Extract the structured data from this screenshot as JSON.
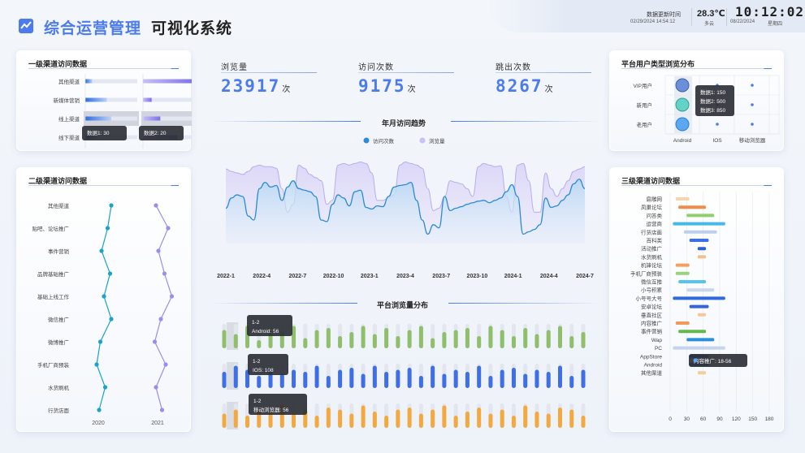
{
  "header": {
    "title_primary": "综合运营管理",
    "title_secondary": "可视化系统",
    "update_label": "数据更新时间",
    "update_time": "02/29/2024 14:54:12",
    "temperature": "28.3℃",
    "weather": "多云",
    "clock": "10:12:02",
    "date": "08/22/2024",
    "weekday": "星期四"
  },
  "stats": [
    {
      "label": "浏览量",
      "value": "23917",
      "unit": "次"
    },
    {
      "label": "访问次数",
      "value": "9175",
      "unit": "次"
    },
    {
      "label": "跳出次数",
      "value": "8267",
      "unit": "次"
    }
  ],
  "colors": {
    "accent": "#4b7bec",
    "teal": "#1aa3c9",
    "purple": "#9b8df0",
    "green": "#8fbf6a",
    "blue": "#3f6fe6",
    "orange": "#f4a940"
  },
  "chart_data": [
    {
      "type": "bar",
      "title": "一级渠道访问数据",
      "categories": [
        "其他渠道",
        "新媒体营销",
        "线上渠道",
        "线下渠道"
      ],
      "series": [
        {
          "name": "数据1",
          "values": [
            8,
            25,
            30,
            15
          ]
        },
        {
          "name": "数据2",
          "values": [
            60,
            10,
            20,
            40
          ]
        }
      ],
      "ylim": [
        0,
        60
      ],
      "tooltips": [
        {
          "label": "数据1:",
          "value": "30"
        },
        {
          "label": "数据2:",
          "value": "20"
        }
      ]
    },
    {
      "type": "line",
      "title": "二级渠道访问数据",
      "categories": [
        "其他渠道",
        "贴吧、论坛推广",
        "事件营销",
        "品牌基础推广",
        "基础上线工作",
        "微信推广",
        "微博推广",
        "手机厂商预装",
        "水货刷机",
        "行货店面"
      ],
      "series": [
        {
          "name": "2020",
          "values": [
            80,
            65,
            40,
            75,
            50,
            80,
            35,
            20,
            55,
            30
          ]
        },
        {
          "name": "2021",
          "values": [
            20,
            70,
            30,
            55,
            85,
            40,
            15,
            60,
            20,
            45
          ]
        }
      ]
    },
    {
      "type": "area",
      "title": "年月访问趋势",
      "x": [
        "2022-1",
        "2022-4",
        "2022-7",
        "2022-10",
        "2023-1",
        "2023-4",
        "2023-7",
        "2023-10",
        "2024-1",
        "2024-4",
        "2024-7"
      ],
      "series": [
        {
          "name": "访问次数",
          "values": [
            45,
            58,
            62,
            60,
            35,
            30,
            70,
            78,
            72,
            74,
            55,
            72,
            80,
            70,
            68,
            66,
            60,
            30,
            28,
            50,
            62,
            58,
            48,
            66,
            68,
            46,
            44,
            48,
            47,
            60,
            72,
            74,
            75,
            78,
            55,
            30,
            12,
            24,
            20,
            60,
            42,
            45,
            47,
            50,
            52,
            54,
            55,
            52,
            55,
            58,
            66,
            75,
            60,
            12,
            15,
            18,
            24,
            58,
            46,
            48,
            55,
            62,
            76,
            82,
            70
          ]
        },
        {
          "name": "浏览量",
          "values": [
            95,
            92,
            90,
            88,
            92,
            98,
            100,
            98,
            98,
            96,
            70,
            40,
            50,
            100,
            96,
            88,
            84,
            80,
            50,
            55,
            100,
            102,
            100,
            102,
            104,
            102,
            90,
            55,
            55,
            58,
            62,
            100,
            104,
            102,
            100,
            96,
            70,
            42,
            45,
            60,
            80,
            78,
            76,
            70,
            60,
            98,
            102,
            100,
            98,
            99,
            60,
            40,
            100,
            102,
            80,
            40,
            40,
            90,
            70,
            60,
            70,
            80,
            92,
            95,
            98
          ]
        }
      ],
      "ylim": [
        0,
        120
      ]
    },
    {
      "type": "bar",
      "title": "平台浏览量分布",
      "categories": [
        "Android",
        "IOS",
        "移动浏览器"
      ],
      "series": [
        {
          "name": "Android",
          "values": [
            45,
            35,
            55,
            20,
            45,
            40,
            55,
            25,
            45,
            50,
            30,
            40,
            55,
            35,
            50,
            30,
            45,
            55,
            25,
            40,
            45,
            50,
            30,
            55,
            45,
            30,
            50,
            35,
            45,
            55,
            30,
            40
          ]
        },
        {
          "name": "IOS",
          "values": [
            40,
            55,
            45,
            30,
            50,
            35,
            45,
            40,
            55,
            30,
            45,
            50,
            35,
            55,
            40,
            45,
            50,
            30,
            55,
            35,
            45,
            40,
            55,
            30,
            45,
            50,
            35,
            45,
            40,
            55,
            30,
            45
          ]
        },
        {
          "name": "移动浏览器",
          "values": [
            35,
            45,
            30,
            50,
            40,
            55,
            35,
            45,
            30,
            50,
            45,
            35,
            55,
            40,
            30,
            45,
            50,
            35,
            45,
            55,
            30,
            40,
            50,
            35,
            45,
            30,
            55,
            40,
            35,
            50,
            45,
            30
          ]
        }
      ],
      "tooltips": [
        {
          "head": "1-2",
          "label": "Android:",
          "value": "56"
        },
        {
          "head": "1-2",
          "label": "IOS:",
          "value": "108"
        },
        {
          "head": "1-2",
          "label": "移动浏览器:",
          "value": "56"
        }
      ]
    },
    {
      "type": "scatter",
      "title": "平台用户类型浏览分布",
      "x": [
        "Android",
        "IOS",
        "移动浏览器"
      ],
      "y": [
        "VIP用户",
        "新用户",
        "老用户"
      ],
      "tooltip": [
        {
          "label": "数据1:",
          "value": "150"
        },
        {
          "label": "数据2:",
          "value": "500"
        },
        {
          "label": "数据3:",
          "value": "850"
        }
      ]
    },
    {
      "type": "bar",
      "title": "三级渠道访问数据",
      "categories": [
        "扈雕网",
        "凤巢论坛",
        "问答类",
        "运营商",
        "行货店面",
        "百科类",
        "活动推广",
        "水货刷机",
        "机锋论坛",
        "手机厂商预装",
        "微信互推",
        "小号积累",
        "小号号大号",
        "安卓论坛",
        "垂直社区",
        "内容推广",
        "事件营销",
        "Wap",
        "PC",
        "AppStore",
        "Android",
        "其他渠道"
      ],
      "ranges": [
        [
          10,
          35
        ],
        [
          15,
          65
        ],
        [
          30,
          80
        ],
        [
          5,
          100
        ],
        [
          25,
          85
        ],
        [
          35,
          70
        ],
        [
          50,
          65
        ],
        [
          50,
          65
        ],
        [
          10,
          35
        ],
        [
          10,
          35
        ],
        [
          15,
          65
        ],
        [
          30,
          80
        ],
        [
          5,
          100
        ],
        [
          35,
          70
        ],
        [
          50,
          65
        ],
        [
          10,
          35
        ],
        [
          15,
          65
        ],
        [
          30,
          80
        ],
        [
          5,
          100
        ],
        [
          35,
          70
        ],
        [
          35,
          70
        ],
        [
          50,
          65
        ]
      ],
      "xticks": [
        "0",
        "30",
        "60",
        "90",
        "120",
        "150",
        "180"
      ],
      "xlim": [
        0,
        180
      ],
      "tooltip": {
        "label": "内容推广:",
        "value": "18-56"
      }
    }
  ],
  "legend_trend": [
    "访问次数",
    "浏览量"
  ],
  "line_years": [
    "2020",
    "2021"
  ]
}
